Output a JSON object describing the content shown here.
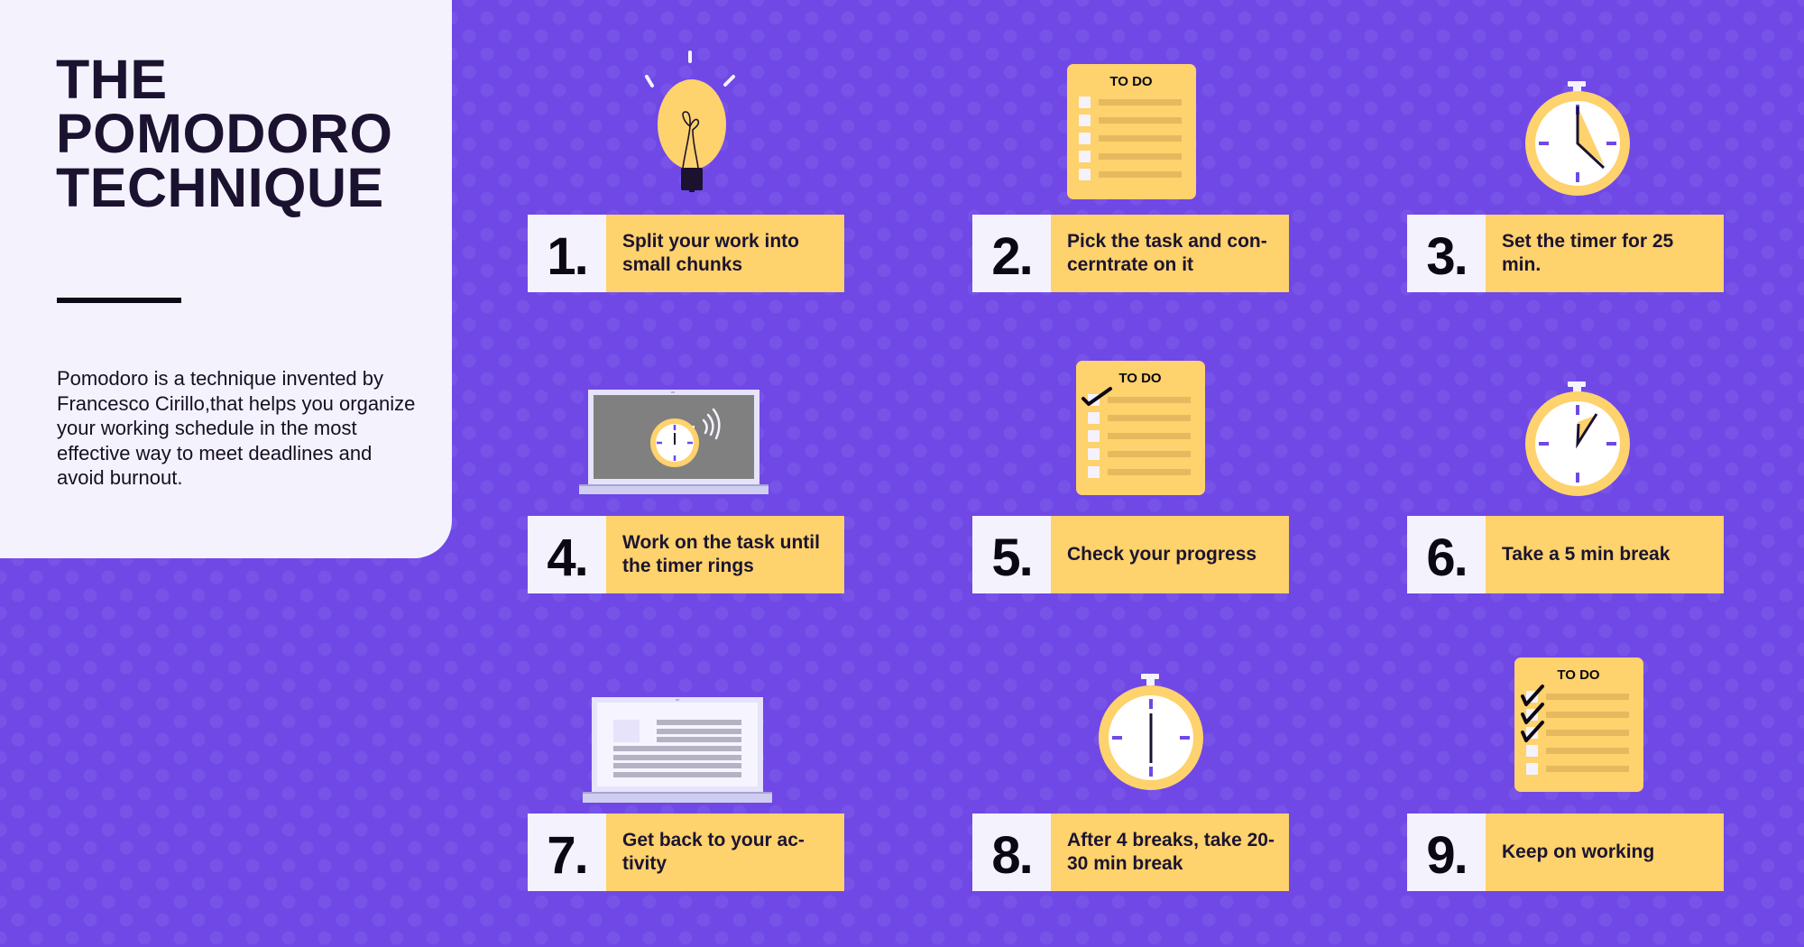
{
  "panel": {
    "title_lines": [
      "THE",
      "POMODORO",
      "TECHNIQUE"
    ],
    "description": "Pomodoro is a technique invented by Francesco Cirillo,that helps you organize your working schedule in the most effective way to meet deadlines and avoid burnout."
  },
  "steps": [
    {
      "number": "1.",
      "text": "Split your work into small chunks",
      "icon": "lightbulb-icon"
    },
    {
      "number": "2.",
      "text": "Pick the task and con-cerntrate on it",
      "icon": "todo-list-icon"
    },
    {
      "number": "3.",
      "text": "Set the timer for 25 min.",
      "icon": "stopwatch-icon"
    },
    {
      "number": "4.",
      "text": "Work on the task until the timer rings",
      "icon": "laptop-ringing-timer-icon"
    },
    {
      "number": "5.",
      "text": "Check your progress",
      "icon": "todo-list-one-checked-icon"
    },
    {
      "number": "6.",
      "text": "Take a 5 min break",
      "icon": "stopwatch-icon"
    },
    {
      "number": "7.",
      "text": "Get back to your ac-tivity",
      "icon": "laptop-document-icon"
    },
    {
      "number": "8.",
      "text": "After 4 breaks, take 20-30 min break",
      "icon": "stopwatch-icon"
    },
    {
      "number": "9.",
      "text": "Keep on working",
      "icon": "todo-list-three-checked-icon"
    }
  ],
  "todo_label": "TO DO",
  "colors": {
    "background": "#6f48e6",
    "panel": "#f4f2fd",
    "card_yellow": "#fed26c",
    "text_dark": "#1c1430",
    "accent_purple": "#6f48e6"
  }
}
